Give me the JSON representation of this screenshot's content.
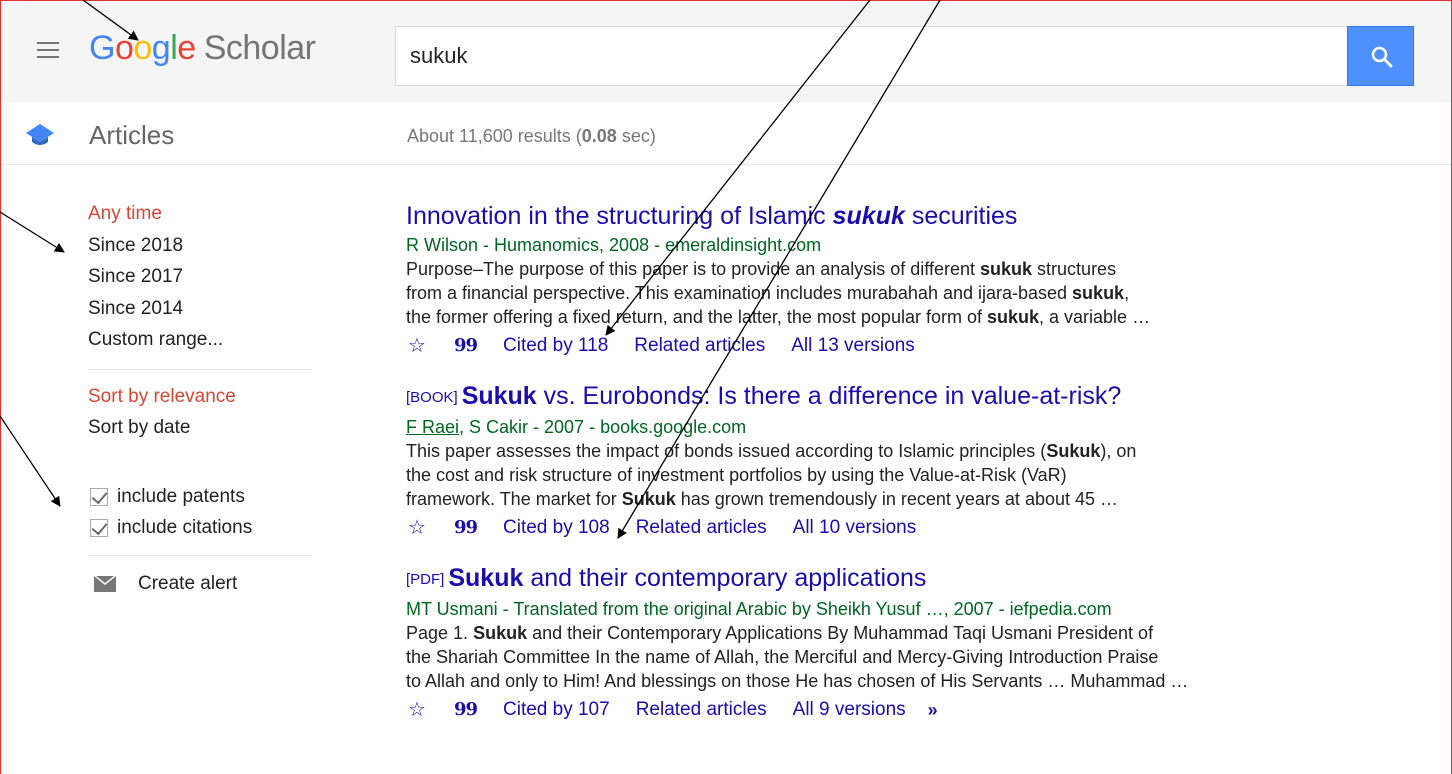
{
  "header": {
    "logo_g": "G",
    "logo_o1": "o",
    "logo_o2": "o",
    "logo_g2": "g",
    "logo_l": "l",
    "logo_e": "e",
    "logo_scholar": "Scholar",
    "search_value": "sukuk"
  },
  "subbar": {
    "section_label": "Articles",
    "stats_prefix": "About 11,600 results (",
    "stats_time": "0.08",
    "stats_suffix": " sec)"
  },
  "sidebar": {
    "time_filters": [
      "Any time",
      "Since 2018",
      "Since 2017",
      "Since 2014",
      "Custom range..."
    ],
    "sort_options": [
      "Sort by relevance",
      "Sort by date"
    ],
    "checkboxes": [
      "include patents",
      "include citations"
    ],
    "create_alert": "Create alert"
  },
  "results": [
    {
      "tag": "",
      "title_pre": "Innovation in the structuring of Islamic ",
      "title_em": "sukuk",
      "title_post": " securities",
      "meta_authors": "R Wilson",
      "meta_rest": " - Humanomics, 2008 - emeraldinsight.com",
      "snippet_lines": [
        [
          "Purpose–The purpose of this paper is to provide an analysis of different ",
          "sukuk",
          " structures"
        ],
        [
          "from a financial perspective. This examination includes murabahah and ijara-based ",
          "sukuk",
          ","
        ],
        [
          "the former offering a fixed return, and the latter, the most popular form of ",
          "sukuk",
          ", a variable …"
        ]
      ],
      "cited_by": "Cited by 118",
      "related": "Related articles",
      "versions": "All 13 versions"
    },
    {
      "tag": "[BOOK]",
      "title_bold": "Sukuk",
      "title_post": " vs. Eurobonds: Is there a difference in value-at-risk?",
      "meta_authors": "F Raei",
      "meta_rest": ", S Cakir - 2007 - books.google.com",
      "snippet_lines": [
        [
          "This paper assesses the impact of bonds issued according to Islamic principles (",
          "Sukuk",
          "), on"
        ],
        [
          "the cost and risk structure of investment portfolios by using the Value-at-Risk (VaR)",
          "",
          ""
        ],
        [
          "framework. The market for ",
          "Sukuk",
          " has grown tremendously in recent years at about 45 …"
        ]
      ],
      "cited_by": "Cited by 108",
      "related": "Related articles",
      "versions": "All 10 versions"
    },
    {
      "tag": "[PDF]",
      "title_bold": "Sukuk",
      "title_post": " and their contemporary applications",
      "meta_authors": "",
      "meta_rest": "MT Usmani - Translated from the original Arabic by Sheikh Yusuf …, 2007 - iefpedia.com",
      "snippet_lines": [
        [
          "Page 1. ",
          "Sukuk",
          " and their Contemporary Applications By Muhammad Taqi Usmani President of"
        ],
        [
          "the Shariah Committee In the name of Allah, the Merciful and Mercy-Giving Introduction Praise",
          "",
          ""
        ],
        [
          "to Allah and only to Him! And blessings on those He has chosen of His Servants … Muhammad …",
          "",
          ""
        ]
      ],
      "cited_by": "Cited by 107",
      "related": "Related articles",
      "versions": "All 9 versions"
    }
  ],
  "icons": {
    "star": "☆",
    "quote": "99",
    "more": "»"
  },
  "colors": {
    "link": "#1a0dab",
    "meta_green": "#006621",
    "active_red": "#d14836",
    "search_blue": "#4d90fe"
  }
}
